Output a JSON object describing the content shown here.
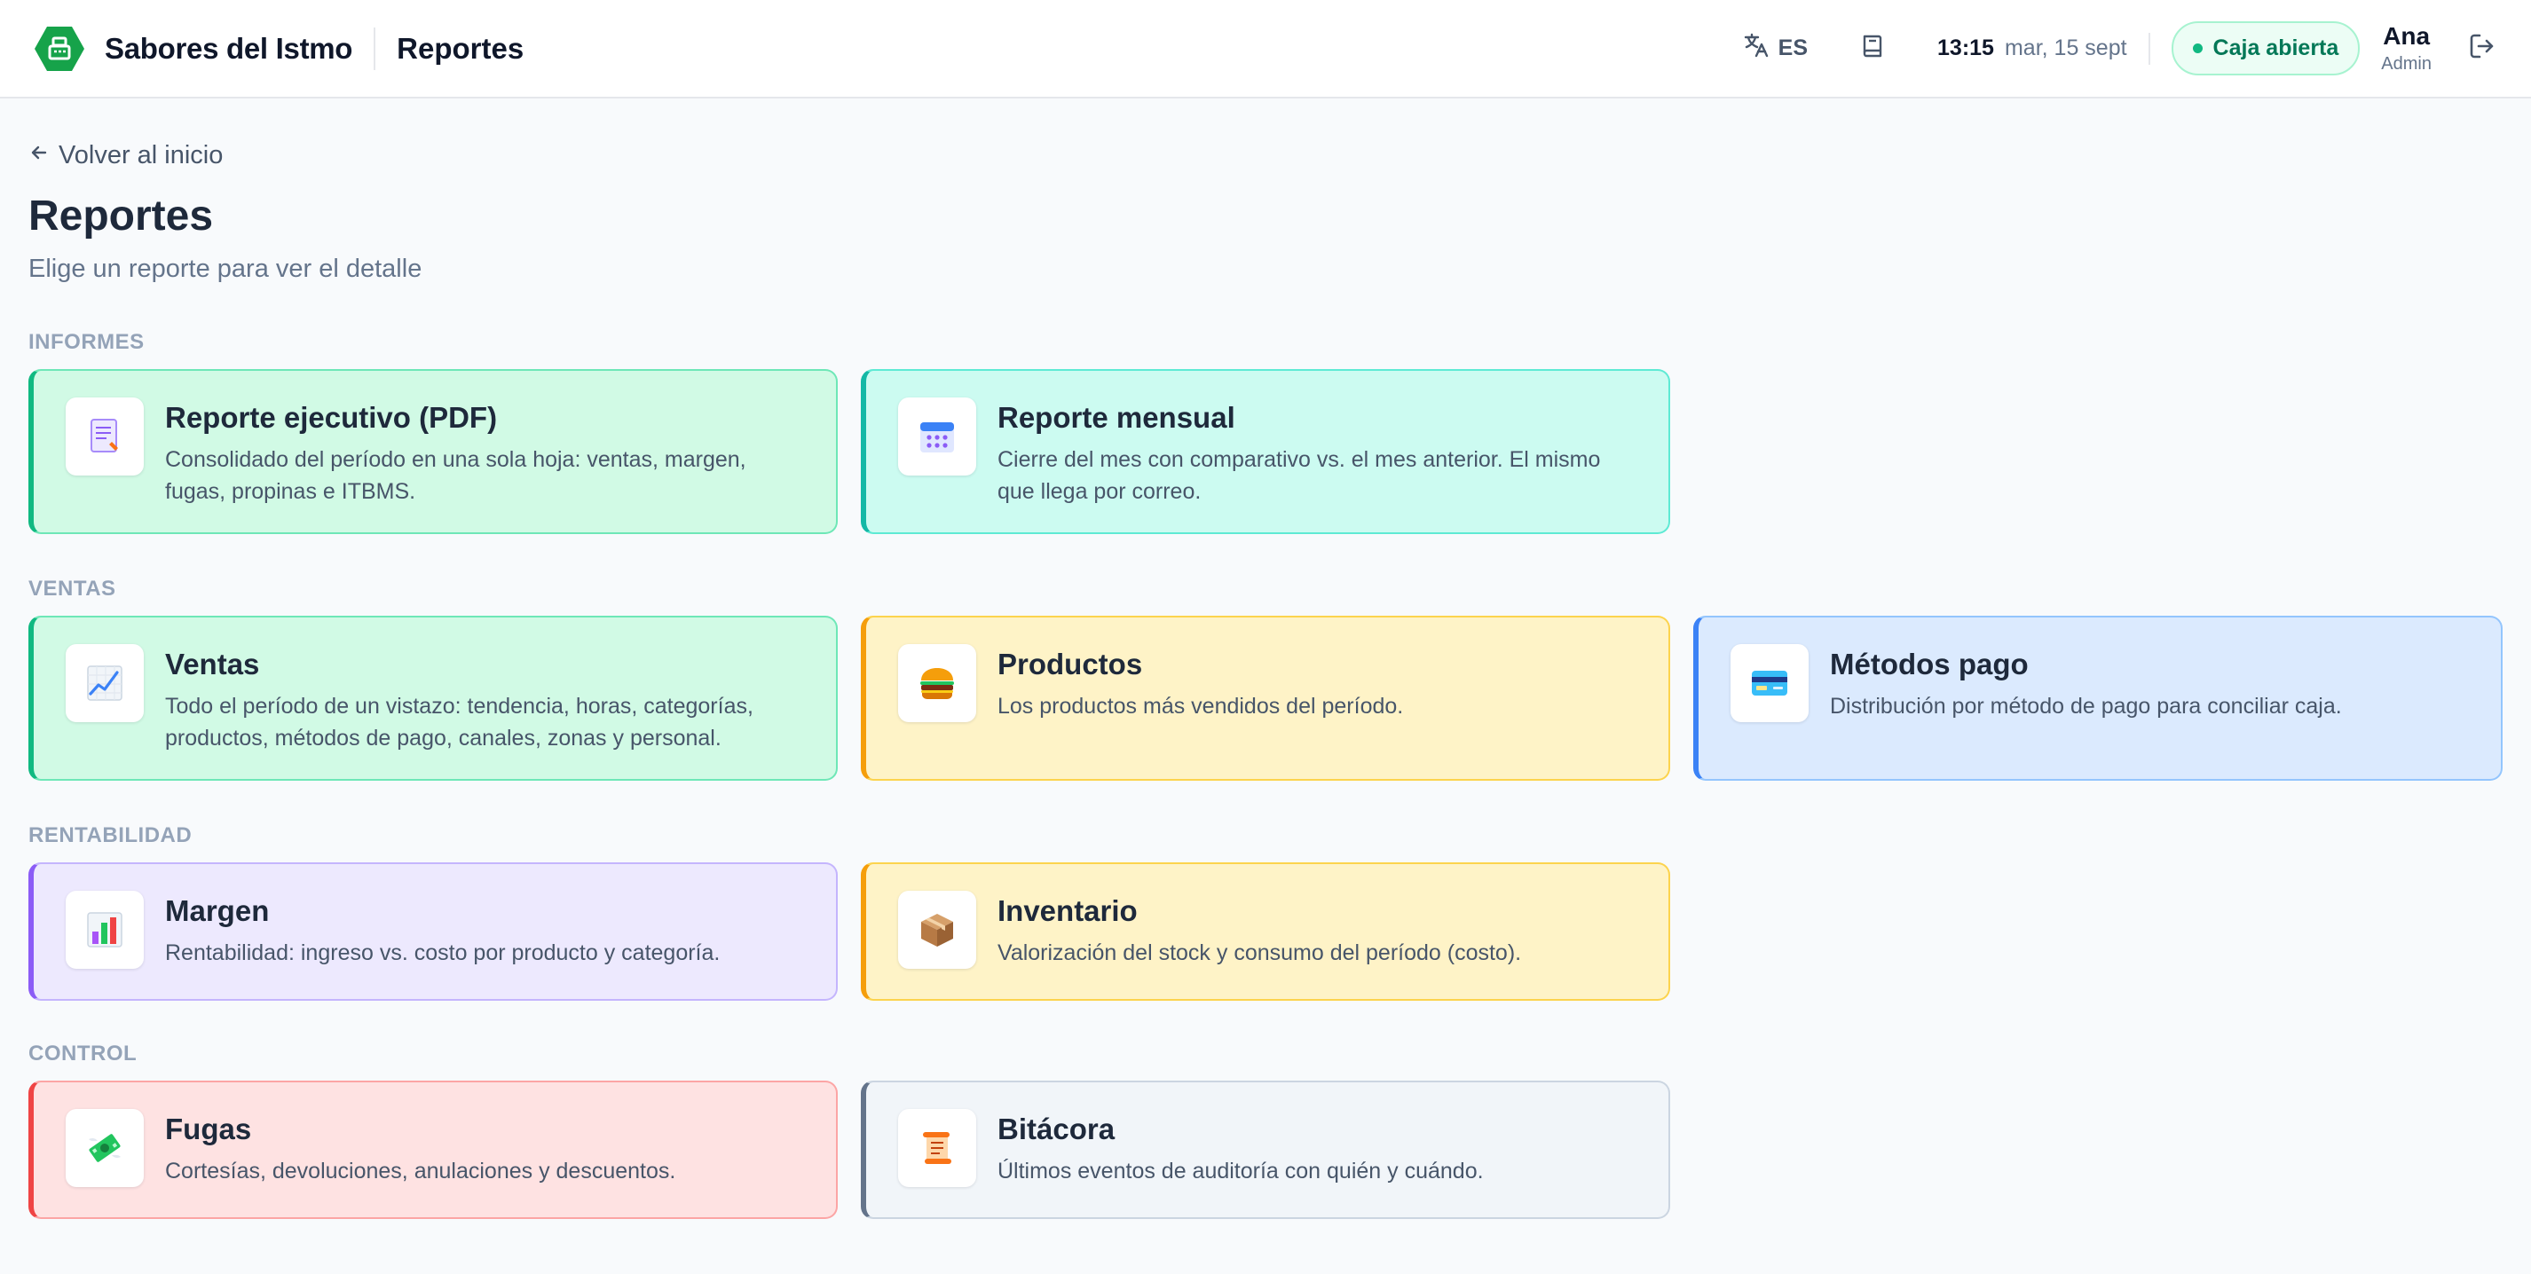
{
  "header": {
    "brand": "Sabores del Istmo",
    "section": "Reportes",
    "language": "ES",
    "time": "13:15",
    "date": "mar, 15 sept",
    "status": "Caja abierta",
    "user_name": "Ana",
    "user_role": "Admin",
    "colors": {
      "brand": "#16a34a",
      "status": "#047857"
    }
  },
  "page": {
    "back_link": "Volver al inicio",
    "title": "Reportes",
    "subtitle": "Elige un reporte para ver el detalle"
  },
  "groups": [
    {
      "label": "INFORMES",
      "cards": [
        {
          "title": "Reporte ejecutivo (PDF)",
          "description": "Consolidado del período en una sola hoja: ventas, margen, fugas, propinas e ITBMS.",
          "icon": "document-icon",
          "accent": "#10b981"
        },
        {
          "title": "Reporte mensual",
          "description": "Cierre del mes con comparativo vs. el mes anterior. El mismo que llega por correo.",
          "icon": "calendar-icon",
          "accent": "#14b8a6"
        }
      ]
    },
    {
      "label": "VENTAS",
      "cards": [
        {
          "title": "Ventas",
          "description": "Todo el período de un vistazo: tendencia, horas, categorías, productos, métodos de pago, canales, zonas y personal.",
          "icon": "trend-chart-icon",
          "accent": "#10b981"
        },
        {
          "title": "Productos",
          "description": "Los productos más vendidos del período.",
          "icon": "burger-icon",
          "accent": "#f59e0b"
        },
        {
          "title": "Métodos pago",
          "description": "Distribución por método de pago para conciliar caja.",
          "icon": "credit-card-icon",
          "accent": "#3b82f6"
        }
      ]
    },
    {
      "label": "RENTABILIDAD",
      "cards": [
        {
          "title": "Margen",
          "description": "Rentabilidad: ingreso vs. costo por producto y categoría.",
          "icon": "bar-chart-icon",
          "accent": "#8b5cf6"
        },
        {
          "title": "Inventario",
          "description": "Valorización del stock y consumo del período (costo).",
          "icon": "package-icon",
          "accent": "#f59e0b"
        }
      ]
    },
    {
      "label": "CONTROL",
      "cards": [
        {
          "title": "Fugas",
          "description": "Cortesías, devoluciones, anulaciones y descuentos.",
          "icon": "money-wings-icon",
          "accent": "#ef4444"
        },
        {
          "title": "Bitácora",
          "description": "Últimos eventos de auditoría con quién y cuándo.",
          "icon": "scroll-icon",
          "accent": "#64748b"
        }
      ]
    }
  ]
}
